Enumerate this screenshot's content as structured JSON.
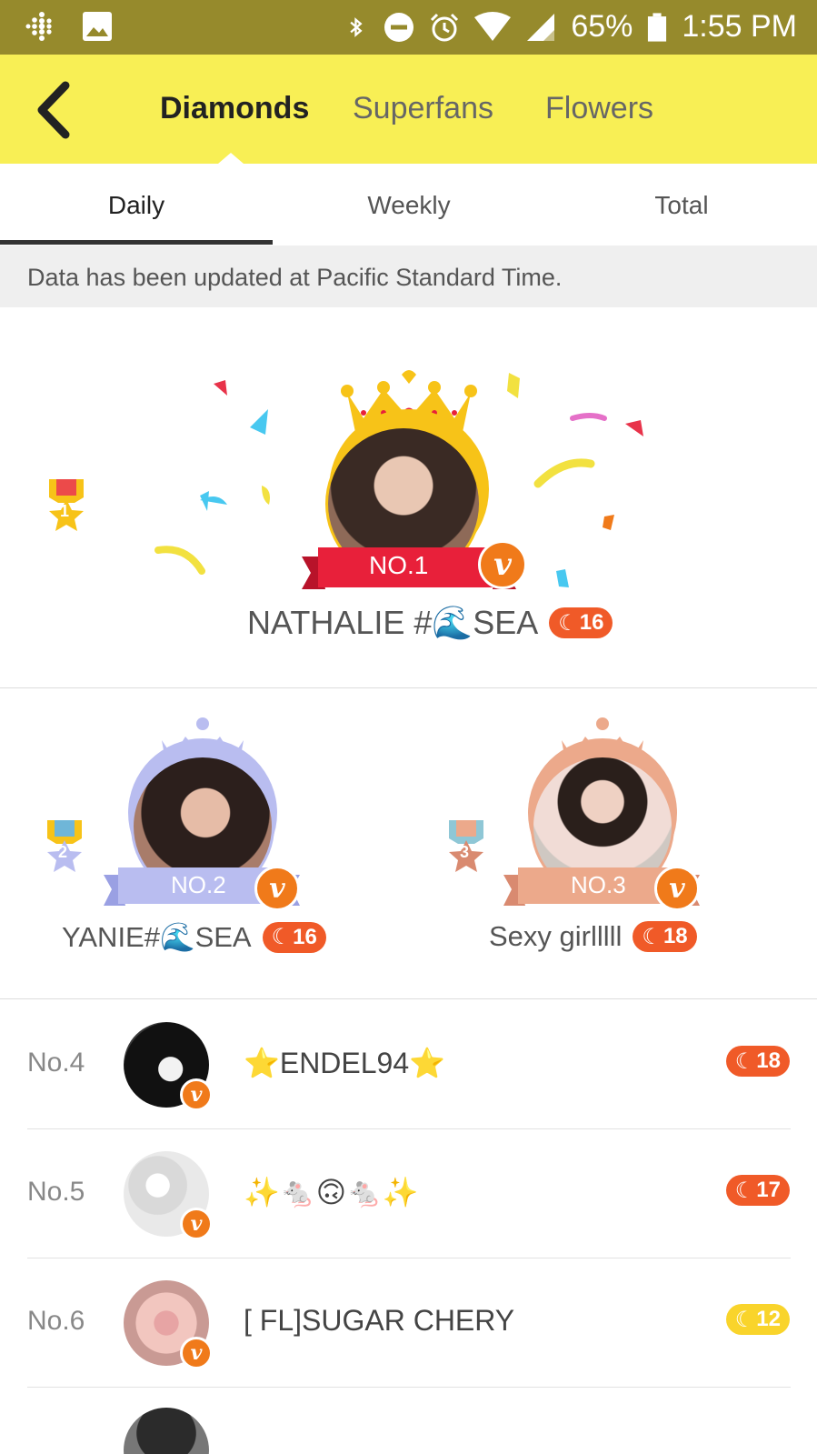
{
  "status_bar": {
    "battery": "65%",
    "time": "1:55 PM",
    "icons": [
      "fitbit-icon",
      "gallery-icon",
      "bluetooth-icon",
      "dnd-icon",
      "alarm-icon",
      "wifi-icon",
      "signal-icon",
      "battery-icon"
    ]
  },
  "nav": {
    "back_icon": "chevron-left-icon",
    "tabs": [
      {
        "label": "Diamonds",
        "active": true
      },
      {
        "label": "Superfans",
        "active": false
      },
      {
        "label": "Flowers",
        "active": false
      }
    ]
  },
  "subtabs": [
    {
      "label": "Daily",
      "active": true
    },
    {
      "label": "Weekly",
      "active": false
    },
    {
      "label": "Total",
      "active": false
    }
  ],
  "notice": "Data has been updated at Pacific Standard Time.",
  "podium": {
    "first": {
      "rank_label": "NO.1",
      "medal_number": "1",
      "name": "NATHALIE #🌊SEA",
      "level": "16",
      "level_color": "orange"
    },
    "second": {
      "rank_label": "NO.2",
      "medal_number": "2",
      "name": "YANIE#🌊SEA",
      "level": "16",
      "level_color": "orange"
    },
    "third": {
      "rank_label": "NO.3",
      "medal_number": "3",
      "name": "Sexy girlllll",
      "level": "18",
      "level_color": "orange"
    }
  },
  "list": [
    {
      "rank": "No.4",
      "name": "⭐ENDEL94⭐",
      "level": "18",
      "level_color": "orange"
    },
    {
      "rank": "No.5",
      "name": "✨🐁🙃🐁✨",
      "level": "17",
      "level_color": "orange"
    },
    {
      "rank": "No.6",
      "name": "[ FL]SUGAR CHERY",
      "level": "12",
      "level_color": "yellow"
    }
  ],
  "colors": {
    "status_bar": "#968a2c",
    "nav_bg": "#f8ef55",
    "level_orange": "#f05a28",
    "level_yellow": "#f9d42b",
    "gold": "#f7c318",
    "silver_lavender": "#b9bdf0",
    "bronze": "#eca98b",
    "ribbon_red": "#e8203a"
  }
}
